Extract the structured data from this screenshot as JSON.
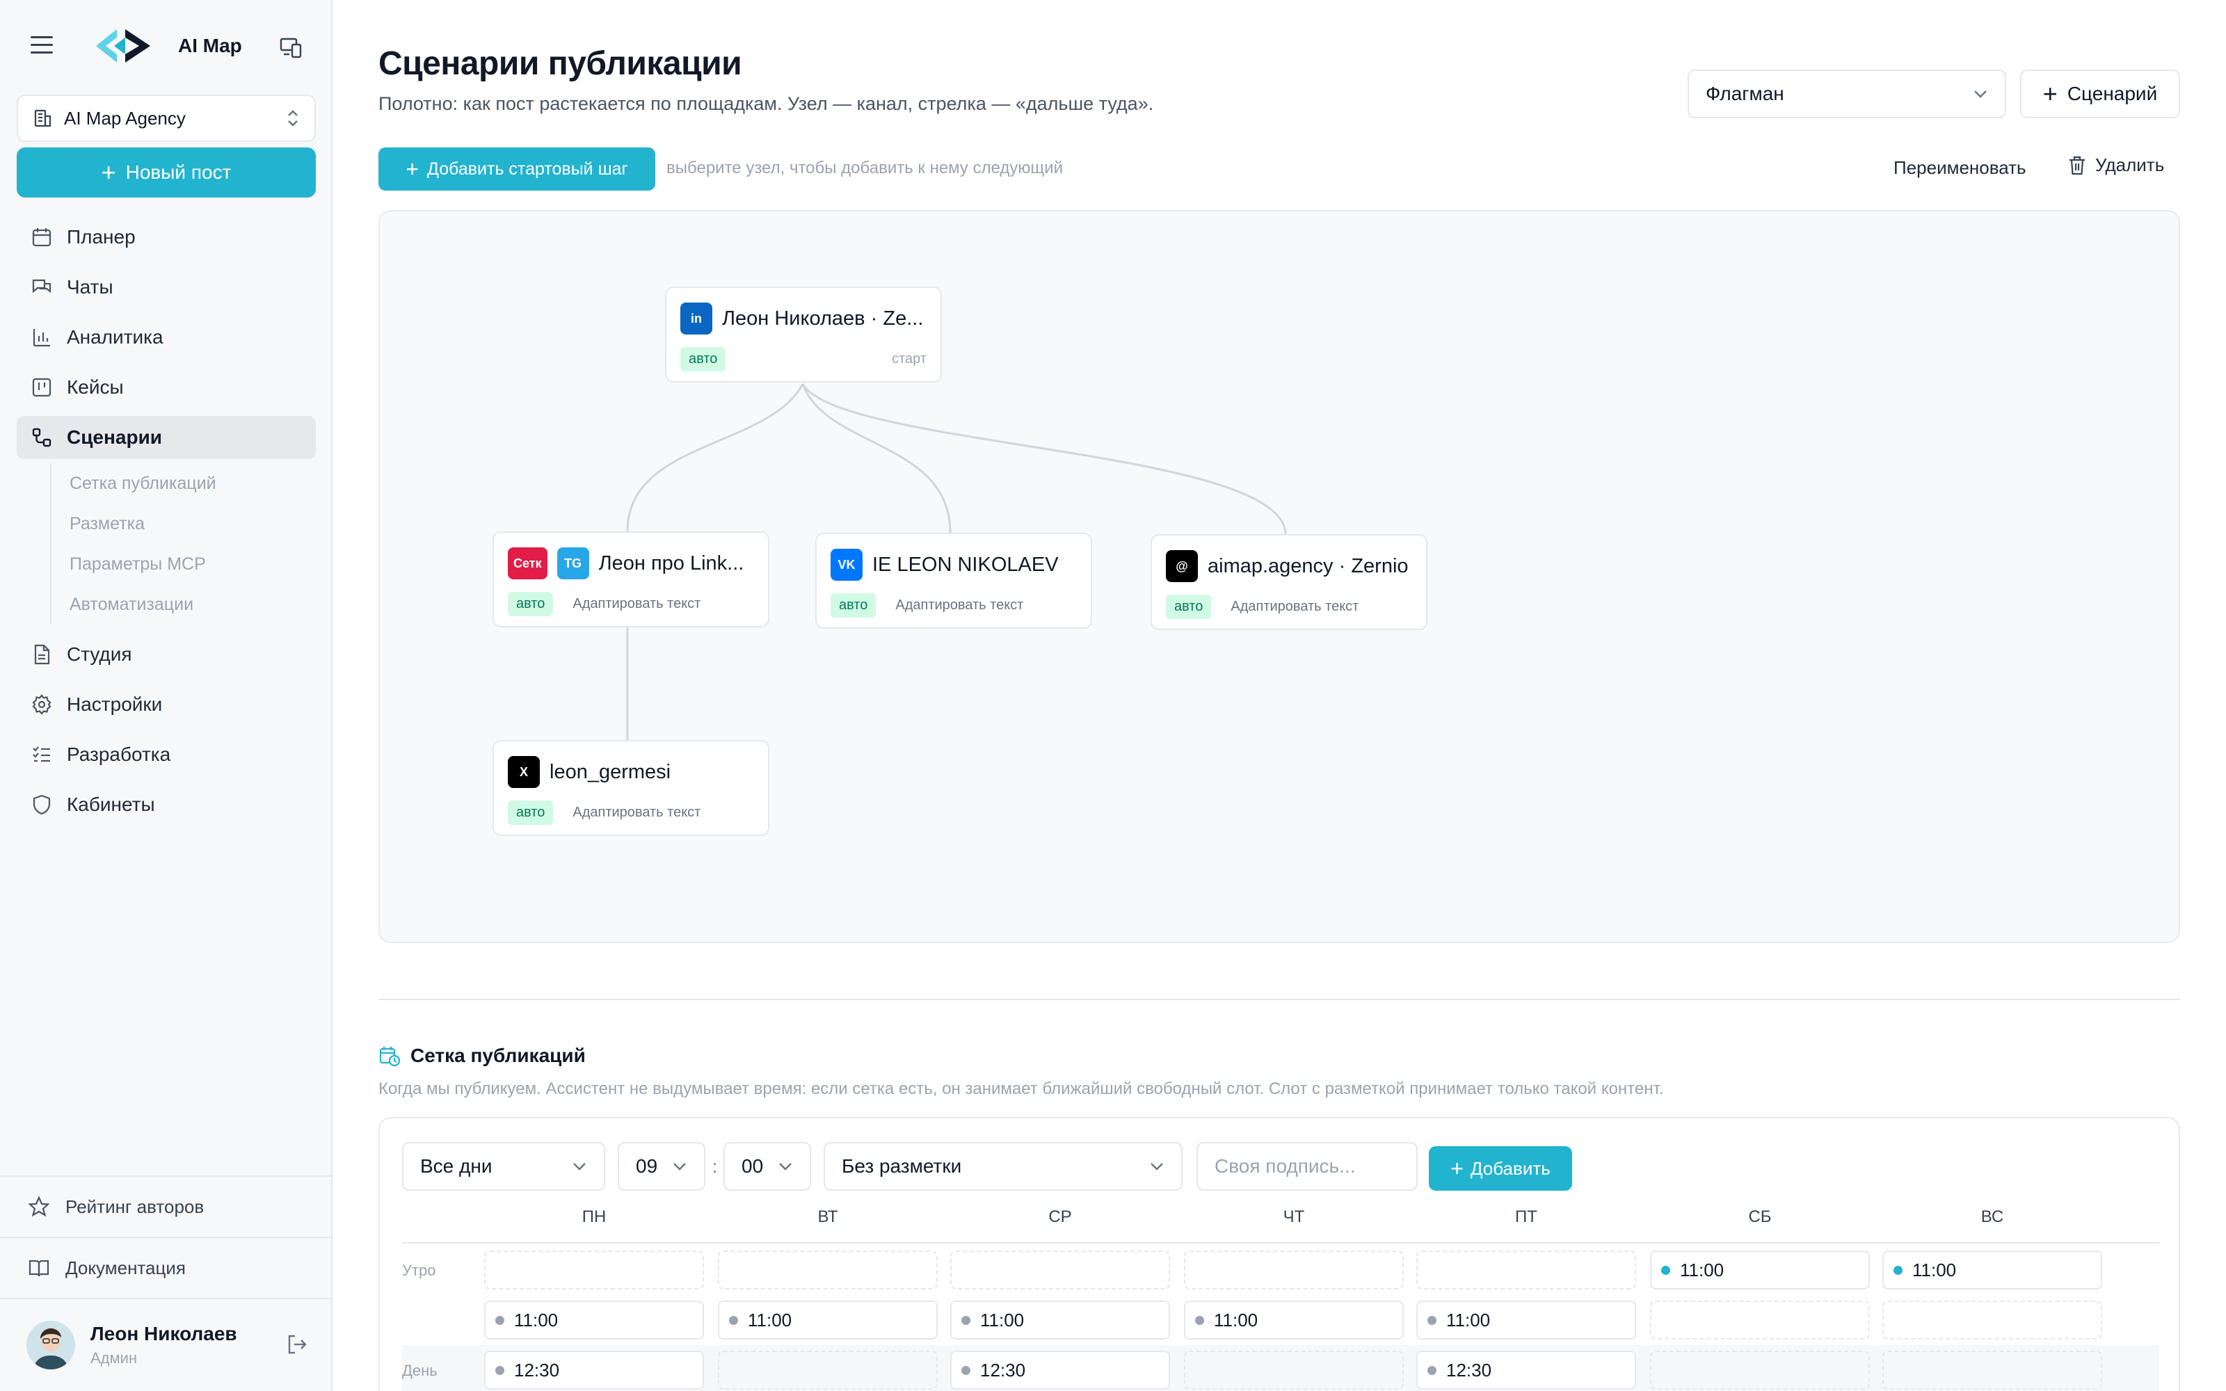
{
  "app": {
    "name": "AI Map",
    "workspace": "AI Map Agency",
    "new_post": "Новый пост"
  },
  "nav": {
    "planner": "Планер",
    "chats": "Чаты",
    "analytics": "Аналитика",
    "cases": "Кейсы",
    "scenarios": "Сценарии",
    "sub": [
      "Сетка публикаций",
      "Разметка",
      "Параметры MCP",
      "Автоматизации"
    ],
    "studio": "Студия",
    "settings": "Настройки",
    "development": "Разработка",
    "cabinets": "Кабинеты"
  },
  "sidebar_bottom": {
    "rating": "Рейтинг авторов",
    "docs": "Документация",
    "user_name": "Леон Николаев",
    "user_role": "Админ"
  },
  "header": {
    "title": "Сценарии публикации",
    "subtitle": "Полотно: как пост растекается по площадкам. Узел — канал, стрелка — «дальше туда».",
    "scenario_select": "Флагман",
    "new_scenario": "Сценарий"
  },
  "toolbar": {
    "add_start": "Добавить стартовый шаг",
    "hint": "выберите узел, чтобы добавить к нему следующий",
    "rename": "Переименовать",
    "delete": "Удалить"
  },
  "colors": {
    "accent": "#22b3cf",
    "linkedin": "#0a66c2",
    "setka": "#e11d48",
    "telegram": "#27a7e7",
    "vk": "#0077ff",
    "threads": "#000000",
    "x": "#000000"
  },
  "nodes": [
    {
      "chips": [
        "in"
      ],
      "title": "Леон Николаев · Ze...",
      "badge": "авто",
      "extra": "старт"
    },
    {
      "chips": [
        "Сетк",
        "TG"
      ],
      "title": "Леон про Link...",
      "badge": "авто",
      "extra": "Адаптировать текст"
    },
    {
      "chips": [
        "VK"
      ],
      "title": "IE LEON NIKOLAEV",
      "badge": "авто",
      "extra": "Адаптировать текст"
    },
    {
      "chips": [
        "@"
      ],
      "title": "aimap.agency · Zernio",
      "badge": "авто",
      "extra": "Адаптировать текст"
    },
    {
      "chips": [
        "X"
      ],
      "title": "leon_germesi",
      "badge": "авто",
      "extra": "Адаптировать текст"
    }
  ],
  "grid": {
    "title": "Сетка публикаций",
    "subtitle": "Когда мы публикуем. Ассистент не выдумывает время: если сетка есть, он занимает ближайший свободный слот. Слот с разметкой принимает только такой контент.",
    "days_select": "Все дни",
    "hour": "09",
    "minute": "00",
    "colon": ":",
    "markup_select": "Без разметки",
    "caption_placeholder": "Своя подпись...",
    "add": "Добавить",
    "days": [
      "ПН",
      "ВТ",
      "СР",
      "ЧТ",
      "ПТ",
      "СБ",
      "ВС"
    ],
    "row_labels": [
      "Утро",
      "День"
    ],
    "rows": [
      [
        "",
        "",
        "",
        "",
        "",
        "11:00",
        "11:00"
      ],
      [
        "11:00",
        "11:00",
        "11:00",
        "11:00",
        "11:00",
        "",
        ""
      ],
      [
        "12:30",
        "",
        "12:30",
        "",
        "12:30",
        "",
        ""
      ]
    ],
    "dot_colors": [
      [
        "",
        "",
        "",
        "",
        "",
        "#22b3cf",
        "#22b3cf"
      ],
      [
        "#9ca3af",
        "#9ca3af",
        "#9ca3af",
        "#9ca3af",
        "#9ca3af",
        "",
        ""
      ],
      [
        "#9ca3af",
        "",
        "#9ca3af",
        "",
        "#9ca3af",
        "",
        ""
      ]
    ]
  }
}
